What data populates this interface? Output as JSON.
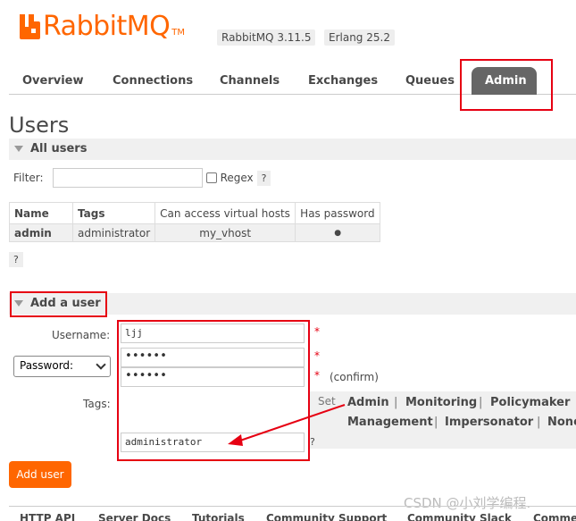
{
  "brand": {
    "name": "RabbitMQ",
    "tm": "TM",
    "version": "RabbitMQ 3.11.5",
    "erlang": "Erlang 25.2",
    "color": "#ff6600"
  },
  "nav": {
    "tabs": [
      "Overview",
      "Connections",
      "Channels",
      "Exchanges",
      "Queues",
      "Admin"
    ],
    "active": "Admin"
  },
  "page": {
    "title": "Users"
  },
  "all_users": {
    "header": "All users",
    "filter_label": "Filter:",
    "filter_value": "",
    "regex_label": "Regex",
    "help": "?",
    "columns": [
      "Name",
      "Tags",
      "Can access virtual hosts",
      "Has password"
    ],
    "rows": [
      {
        "name": "admin",
        "tags": "administrator",
        "vhosts": "my_vhost",
        "has_password": "●"
      }
    ],
    "help_below": "?"
  },
  "add_user": {
    "header": "Add a user",
    "username_label": "Username:",
    "username_value": "ljj",
    "password_select": "Password:",
    "password_value": "••••••",
    "password_confirm_value": "••••••",
    "required_star": "*",
    "confirm_label": "(confirm)",
    "tags_label": "Tags:",
    "tags_value": "administrator",
    "tags_help": "?",
    "tags_set_label": "Set",
    "tag_options": [
      "Admin",
      "Monitoring",
      "Policymaker",
      "Management",
      "Impersonator",
      "None"
    ],
    "tag_separator": "|",
    "submit_label": "Add user"
  },
  "footer": {
    "links": [
      "HTTP API",
      "Server Docs",
      "Tutorials",
      "Community Support",
      "Community Slack",
      "Comme"
    ]
  },
  "watermark": "CSDN @小刘学编程.",
  "annotation_color": "#e60012"
}
